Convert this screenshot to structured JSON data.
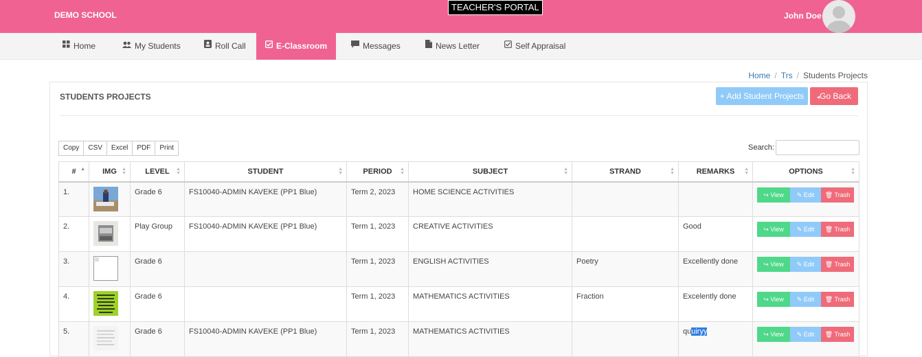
{
  "header": {
    "school_name": "DEMO SCHOOL",
    "portal_label": "TEACHER'S PORTAL",
    "user_name": "John Doe",
    "brand_color": "#f06292"
  },
  "nav": {
    "items": [
      {
        "label": "Home",
        "icon": "grid-icon"
      },
      {
        "label": "My Students",
        "icon": "users-icon"
      },
      {
        "label": "Roll Call",
        "icon": "id-card-icon"
      },
      {
        "label": "E-Classroom",
        "icon": "checkbox-icon",
        "active": true
      },
      {
        "label": "Messages",
        "icon": "comment-icon"
      },
      {
        "label": "News Letter",
        "icon": "file-icon"
      },
      {
        "label": "Self Appraisal",
        "icon": "check-square-icon"
      }
    ]
  },
  "breadcrumb": {
    "items": [
      "Home",
      "Trs",
      "Students Projects"
    ]
  },
  "panel": {
    "title": "STUDENTS PROJECTS",
    "add_button": "+ Add Student Projects",
    "back_button": "Go Back"
  },
  "exports": [
    "Copy",
    "CSV",
    "Excel",
    "PDF",
    "Print"
  ],
  "search": {
    "label": "Search:",
    "value": ""
  },
  "table": {
    "columns": [
      "#",
      "IMG",
      "LEVEL",
      "STUDENT",
      "PERIOD",
      "SUBJECT",
      "STRAND",
      "REMARKS",
      "OPTIONS"
    ],
    "rows": [
      {
        "num": "1.",
        "level": "Grade 6",
        "student": "FS10040-ADMIN KAVEKE (PP1 Blue)",
        "period": "Term 2, 2023",
        "subject": "HOME SCIENCE ACTIVITIES",
        "strand": "",
        "remarks": "",
        "img": "photo-thumbnail"
      },
      {
        "num": "2.",
        "level": "Play Group",
        "student": "FS10040-ADMIN KAVEKE (PP1 Blue)",
        "period": "Term 1, 2023",
        "subject": "CREATIVE ACTIVITIES",
        "strand": "",
        "remarks": "Good",
        "img": "box-thumbnail"
      },
      {
        "num": "3.",
        "level": "Grade 6",
        "student": "",
        "period": "Term 1, 2023",
        "subject": "ENGLISH ACTIVITIES",
        "strand": "Poetry",
        "remarks": "Excellently done",
        "img": "broken-image"
      },
      {
        "num": "4.",
        "level": "Grade 6",
        "student": "",
        "period": "Term 1, 2023",
        "subject": "MATHEMATICS ACTIVITIES",
        "strand": "Fraction",
        "remarks": "Excelently done",
        "img": "poster-thumbnail"
      },
      {
        "num": "5.",
        "level": "Grade 6",
        "student": "FS10040-ADMIN KAVEKE (PP1 Blue)",
        "period": "Term 1, 2023",
        "subject": "MATHEMATICS ACTIVITIES",
        "strand": "",
        "remarks_prefix": "qu",
        "remarks_selected": "uiryy",
        "img": "text-thumbnail"
      }
    ],
    "option_labels": {
      "view": "View",
      "edit": "Edit",
      "trash": "Trash"
    }
  }
}
